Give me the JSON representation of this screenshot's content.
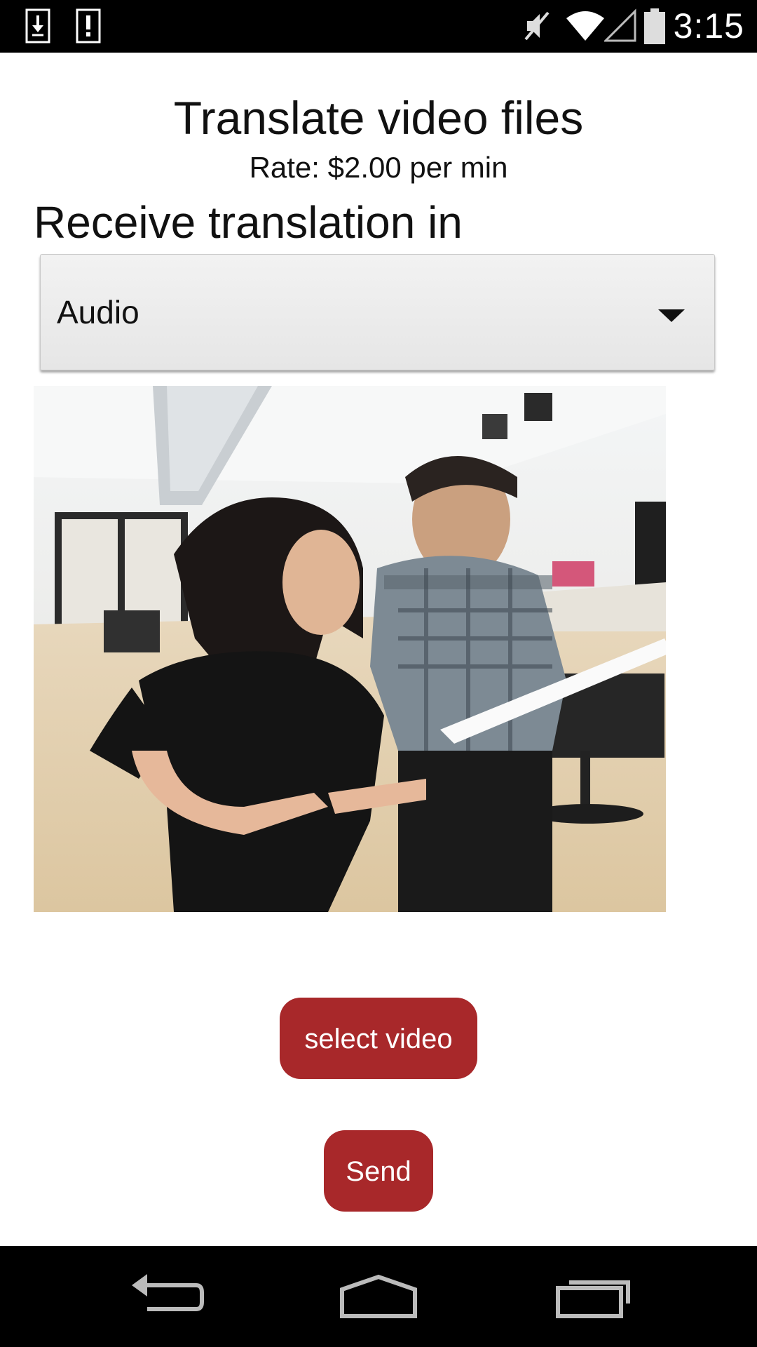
{
  "status_bar": {
    "time": "3:15",
    "icons": [
      "download-icon",
      "alert-icon",
      "mute-icon",
      "wifi-icon",
      "signal-icon",
      "battery-icon"
    ]
  },
  "screen": {
    "title": "Translate video files",
    "rate": "Rate: $2.00 per min",
    "receive_label": "Receive translation in",
    "dropdown": {
      "selected": "Audio"
    },
    "buttons": {
      "select_video": "select video",
      "send": "Send"
    },
    "accent_color": "#a8282a"
  },
  "nav_bar": {
    "icons": [
      "back-icon",
      "home-icon",
      "recent-apps-icon"
    ]
  }
}
